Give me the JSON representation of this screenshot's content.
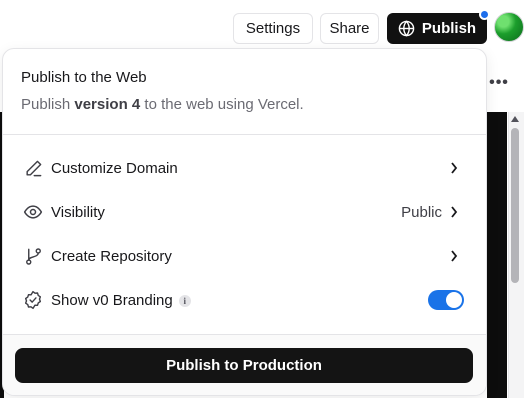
{
  "header": {
    "settings_label": "Settings",
    "share_label": "Share",
    "publish_label": "Publish"
  },
  "popover": {
    "title": "Publish to the Web",
    "subtitle_prefix": "Publish ",
    "subtitle_version": "version 4",
    "subtitle_suffix": " to the web using Vercel.",
    "items": [
      {
        "label": "Customize Domain",
        "icon": "pen-icon"
      },
      {
        "label": "Visibility",
        "value": "Public",
        "icon": "eye-icon"
      },
      {
        "label": "Create Repository",
        "icon": "git-branch-icon"
      },
      {
        "label": "Show v0 Branding",
        "icon": "badge-check-icon",
        "toggle_on": true
      }
    ],
    "cta_label": "Publish to Production"
  },
  "colors": {
    "accent": "#1a73e8",
    "primary_button": "#141414",
    "notification_dot": "#1f6feb"
  }
}
